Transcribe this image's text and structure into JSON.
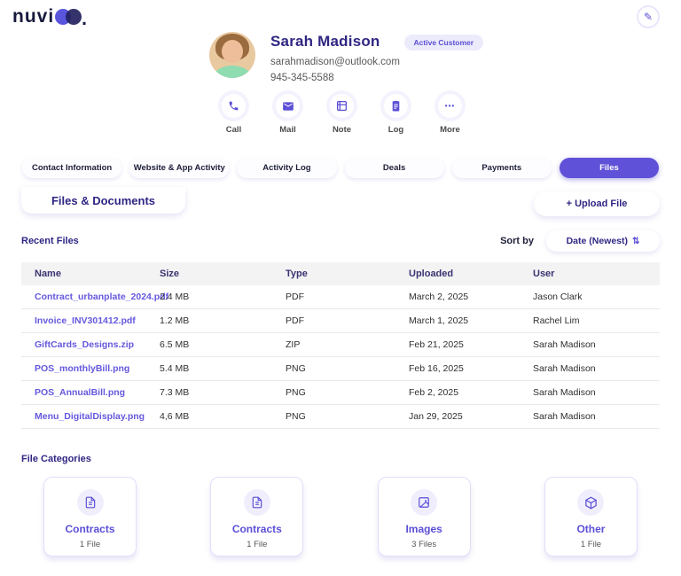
{
  "brand": {
    "logo_text": "nuvi",
    "logo_suffix": "."
  },
  "header": {
    "edit_icon": "✎"
  },
  "profile": {
    "name": "Sarah Madison",
    "email": "sarahmadison@outlook.com",
    "phone": "945-345-5588",
    "badge": "Active Customer",
    "actions": [
      {
        "label": "Call",
        "icon": "phone-icon"
      },
      {
        "label": "Mail",
        "icon": "mail-icon"
      },
      {
        "label": "Note",
        "icon": "note-icon"
      },
      {
        "label": "Log",
        "icon": "log-icon"
      },
      {
        "label": "More",
        "icon": "more-icon",
        "glyph": "•••"
      }
    ]
  },
  "tabs": [
    {
      "label": "Contact Information",
      "active": false
    },
    {
      "label": "Website & App Activity",
      "active": false
    },
    {
      "label": "Activity Log",
      "active": false
    },
    {
      "label": "Deals",
      "active": false
    },
    {
      "label": "Payments",
      "active": false
    },
    {
      "label": "Files",
      "active": true
    }
  ],
  "section": {
    "title": "Files & Documents",
    "upload_label": "+ Upload File"
  },
  "recent_files": {
    "title": "Recent Files",
    "sort_label": "Sort by",
    "sort_value": "Date (Newest)",
    "sort_icon": "⇅",
    "columns": {
      "name": "Name",
      "size": "Size",
      "type": "Type",
      "uploaded": "Uploaded",
      "user": "User"
    },
    "rows": [
      {
        "name": "Contract_urbanplate_2024.pdf",
        "size": "2.4 MB",
        "type": "PDF",
        "uploaded": "March 2, 2025",
        "user": "Jason Clark"
      },
      {
        "name": "Invoice_INV301412.pdf",
        "size": "1.2 MB",
        "type": "PDF",
        "uploaded": "March 1, 2025",
        "user": "Rachel Lim"
      },
      {
        "name": "GiftCards_Designs.zip",
        "size": "6.5 MB",
        "type": "ZIP",
        "uploaded": "Feb 21, 2025",
        "user": "Sarah Madison"
      },
      {
        "name": "POS_monthlyBill.png",
        "size": "5.4 MB",
        "type": "PNG",
        "uploaded": "Feb 16, 2025",
        "user": "Sarah Madison"
      },
      {
        "name": "POS_AnnualBill.png",
        "size": "7.3 MB",
        "type": "PNG",
        "uploaded": "Feb 2, 2025",
        "user": "Sarah Madison"
      },
      {
        "name": "Menu_DigitalDisplay.png",
        "size": "4,6 MB",
        "type": "PNG",
        "uploaded": "Jan 29, 2025",
        "user": "Sarah Madison"
      }
    ]
  },
  "categories": {
    "title": "File Categories",
    "items": [
      {
        "label": "Contracts",
        "count": "1 File",
        "icon": "document-icon"
      },
      {
        "label": "Contracts",
        "count": "1 File",
        "icon": "document-icon"
      },
      {
        "label": "Images",
        "count": "3 Files",
        "icon": "image-icon"
      },
      {
        "label": "Other",
        "count": "1 File",
        "icon": "cube-icon"
      }
    ]
  },
  "colors": {
    "accent": "#5f51d8",
    "link": "#6558dd",
    "heading": "#2f2683",
    "badge_bg": "#ecebfb"
  }
}
